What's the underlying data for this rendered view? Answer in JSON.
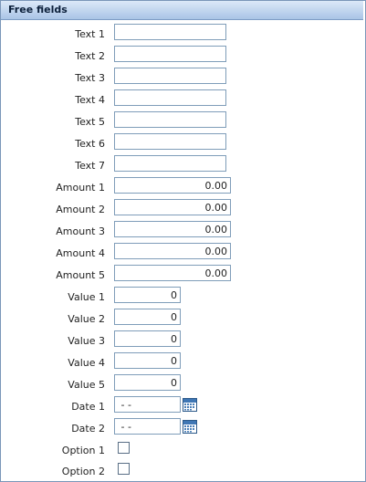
{
  "panel": {
    "title": "Free fields"
  },
  "text_fields": [
    {
      "label": "Text 1",
      "value": ""
    },
    {
      "label": "Text 2",
      "value": ""
    },
    {
      "label": "Text 3",
      "value": ""
    },
    {
      "label": "Text 4",
      "value": ""
    },
    {
      "label": "Text 5",
      "value": ""
    },
    {
      "label": "Text 6",
      "value": ""
    },
    {
      "label": "Text 7",
      "value": ""
    }
  ],
  "amount_fields": [
    {
      "label": "Amount 1",
      "value": "0.00"
    },
    {
      "label": "Amount 2",
      "value": "0.00"
    },
    {
      "label": "Amount 3",
      "value": "0.00"
    },
    {
      "label": "Amount 4",
      "value": "0.00"
    },
    {
      "label": "Amount 5",
      "value": "0.00"
    }
  ],
  "value_fields": [
    {
      "label": "Value 1",
      "value": "0"
    },
    {
      "label": "Value 2",
      "value": "0"
    },
    {
      "label": "Value 3",
      "value": "0"
    },
    {
      "label": "Value 4",
      "value": "0"
    },
    {
      "label": "Value 5",
      "value": "0"
    }
  ],
  "date_fields": [
    {
      "label": "Date 1",
      "value": " - -",
      "icon": "calendar-icon"
    },
    {
      "label": "Date 2",
      "value": " - -",
      "icon": "calendar-icon"
    }
  ],
  "option_fields": [
    {
      "label": "Option 1",
      "checked": false
    },
    {
      "label": "Option 2",
      "checked": false
    }
  ],
  "colors": {
    "header_top": "#dce9f8",
    "header_bottom": "#a9c4e6",
    "border": "#7f9db9"
  }
}
